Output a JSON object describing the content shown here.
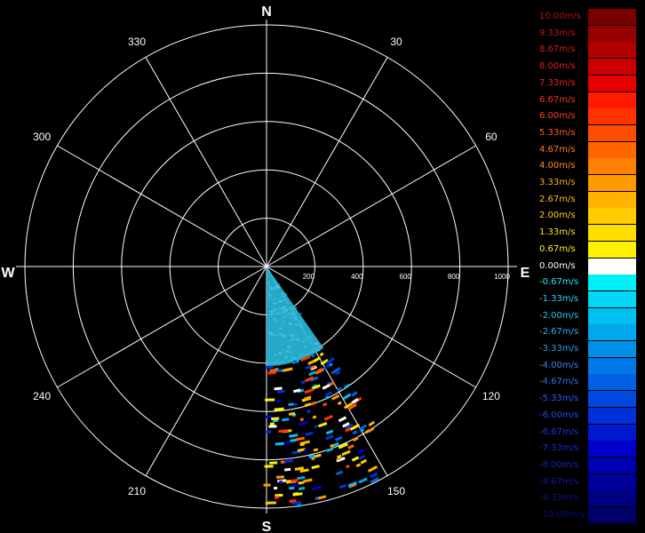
{
  "compass": {
    "north": "N",
    "east": "E",
    "south": "S",
    "west": "W"
  },
  "bearings": [
    "30",
    "60",
    "120",
    "150",
    "210",
    "240",
    "300",
    "330"
  ],
  "range_rings": [
    "200",
    "400",
    "600",
    "800",
    "1000"
  ],
  "legend": {
    "entries": [
      {
        "label": "10.00m/s",
        "color": "#7a0000",
        "text_color": "#b81010"
      },
      {
        "label": "9.33m/s",
        "color": "#960000",
        "text_color": "#c81414"
      },
      {
        "label": "8.67m/s",
        "color": "#b20000",
        "text_color": "#d81818"
      },
      {
        "label": "8.00m/s",
        "color": "#cc0000",
        "text_color": "#e81c1c"
      },
      {
        "label": "7.33m/s",
        "color": "#e60000",
        "text_color": "#f02020"
      },
      {
        "label": "6.67m/s",
        "color": "#ff1a00",
        "text_color": "#f83020"
      },
      {
        "label": "6.00m/s",
        "color": "#ff3300",
        "text_color": "#ff4020"
      },
      {
        "label": "5.33m/s",
        "color": "#ff4d00",
        "text_color": "#ff5a20"
      },
      {
        "label": "4.67m/s",
        "color": "#ff6600",
        "text_color": "#ff7a20"
      },
      {
        "label": "4.00m/s",
        "color": "#ff8000",
        "text_color": "#ff9020"
      },
      {
        "label": "3.33m/s",
        "color": "#ff9900",
        "text_color": "#ffa820"
      },
      {
        "label": "2.67m/s",
        "color": "#ffb300",
        "text_color": "#ffbe20"
      },
      {
        "label": "2.00m/s",
        "color": "#ffcc00",
        "text_color": "#ffd020"
      },
      {
        "label": "1.33m/s",
        "color": "#ffdf00",
        "text_color": "#ffe020"
      },
      {
        "label": "0.67m/s",
        "color": "#fff000",
        "text_color": "#fff020"
      },
      {
        "label": "0.00m/s",
        "color": "#ffffff",
        "text_color": "#ffffff"
      },
      {
        "label": "-0.67m/s",
        "color": "#00f0f8",
        "text_color": "#30e8f0"
      },
      {
        "label": "-1.33m/s",
        "color": "#00d8f5",
        "text_color": "#30d8f0"
      },
      {
        "label": "-2.00m/s",
        "color": "#00c0f0",
        "text_color": "#30c4f0"
      },
      {
        "label": "-2.67m/s",
        "color": "#00a8ee",
        "text_color": "#30b0f0"
      },
      {
        "label": "-3.33m/s",
        "color": "#0090ea",
        "text_color": "#309cf0"
      },
      {
        "label": "-4.00m/s",
        "color": "#0078e6",
        "text_color": "#3088f0"
      },
      {
        "label": "-4.67m/s",
        "color": "#0060e2",
        "text_color": "#3070f0"
      },
      {
        "label": "-5.33m/s",
        "color": "#0048de",
        "text_color": "#2c5cf0"
      },
      {
        "label": "-6.00m/s",
        "color": "#0030d8",
        "text_color": "#2848ec"
      },
      {
        "label": "-6.67m/s",
        "color": "#0018d0",
        "text_color": "#2034e0"
      },
      {
        "label": "-7.33m/s",
        "color": "#0000c8",
        "text_color": "#1828d0"
      },
      {
        "label": "-8.00m/s",
        "color": "#0000b0",
        "text_color": "#1420c0"
      },
      {
        "label": "-8.67m/s",
        "color": "#000098",
        "text_color": "#1018a8"
      },
      {
        "label": "-9.33m/s",
        "color": "#000080",
        "text_color": "#0c1490"
      },
      {
        "label": "-10.00m/s",
        "color": "#000068",
        "text_color": "#0a1078"
      }
    ]
  },
  "colors": {
    "background": "#000000",
    "grid": "#ffffff",
    "near_field_fill": "#2ab8d8"
  }
}
